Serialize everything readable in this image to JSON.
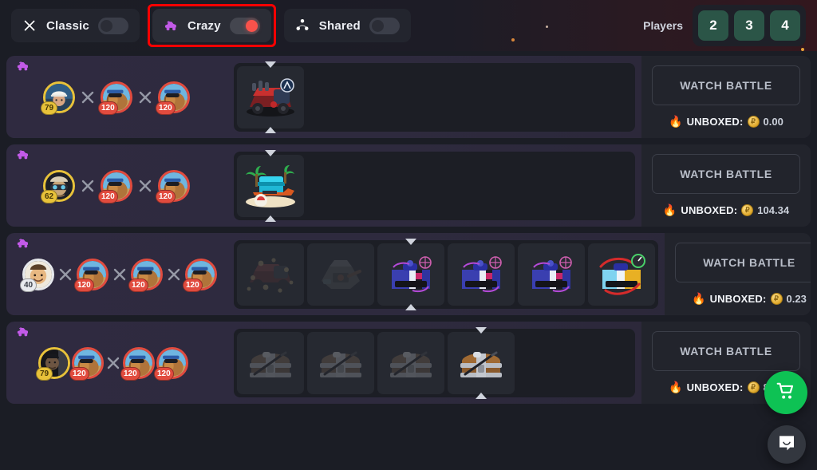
{
  "topbar": {
    "modes": [
      {
        "label": "Classic",
        "icon": "crossed-swords-icon",
        "toggle_on": false
      },
      {
        "label": "Crazy",
        "icon": "crazy-car-icon",
        "toggle_on": true,
        "highlighted": true
      },
      {
        "label": "Shared",
        "icon": "share-nodes-icon",
        "toggle_on": false
      }
    ],
    "players_label": "Players",
    "players_options": [
      "2",
      "3",
      "4"
    ],
    "accent_toggle_on": "#f9524b",
    "accent_players": "#2b5547",
    "highlight_color": "#ff0000"
  },
  "battles": [
    {
      "mode_icon": "crazy-car-icon",
      "layout": "ffa",
      "players": [
        {
          "level": "79",
          "ring": "gold",
          "avatar": "photo-hardhat-man"
        },
        {
          "level": "120",
          "ring": "red",
          "avatar": "photo-dog-sunglasses"
        },
        {
          "level": "120",
          "ring": "red",
          "avatar": "photo-dog-sunglasses"
        }
      ],
      "cases": [
        {
          "art": "war-truck-case",
          "dim": false,
          "marked": true
        }
      ],
      "watch_label": "WATCH BATTLE",
      "unboxed_label": "UNBOXED:",
      "unboxed_value": "0.00"
    },
    {
      "mode_icon": "crazy-car-icon",
      "layout": "ffa",
      "players": [
        {
          "level": "62",
          "ring": "gold",
          "avatar": "photo-goggles-man"
        },
        {
          "level": "120",
          "ring": "red",
          "avatar": "photo-dog-sunglasses"
        },
        {
          "level": "120",
          "ring": "red",
          "avatar": "photo-dog-sunglasses"
        }
      ],
      "cases": [
        {
          "art": "beach-case",
          "dim": false,
          "marked": true
        }
      ],
      "watch_label": "WATCH BATTLE",
      "unboxed_label": "UNBOXED:",
      "unboxed_value": "104.34"
    },
    {
      "mode_icon": "crazy-car-icon",
      "layout": "ffa4",
      "players": [
        {
          "level": "40",
          "ring": "silver",
          "avatar": "photo-smiling-man"
        },
        {
          "level": "120",
          "ring": "red",
          "avatar": "photo-dog-sunglasses"
        },
        {
          "level": "120",
          "ring": "red",
          "avatar": "photo-dog-sunglasses"
        },
        {
          "level": "120",
          "ring": "red",
          "avatar": "photo-dog-sunglasses"
        }
      ],
      "cases": [
        {
          "art": "red-truck-case",
          "dim": true,
          "marked": false
        },
        {
          "art": "grey-mech-case",
          "dim": true,
          "marked": false
        },
        {
          "art": "pink-blue-case",
          "dim": false,
          "marked": true
        },
        {
          "art": "pink-blue-case",
          "dim": false,
          "marked": false
        },
        {
          "art": "pink-blue-case",
          "dim": false,
          "marked": false
        },
        {
          "art": "gold-blue-case",
          "dim": false,
          "marked": false
        }
      ],
      "watch_label": "WATCH BATTLE",
      "unboxed_label": "UNBOXED:",
      "unboxed_value": "0.23"
    },
    {
      "mode_icon": "crazy-car-icon",
      "layout": "team",
      "players": [
        {
          "level": "79",
          "ring": "gold",
          "avatar": "photo-dark-man"
        },
        {
          "level": "120",
          "ring": "red",
          "avatar": "photo-dog-sunglasses"
        },
        {
          "level": "120",
          "ring": "red",
          "avatar": "photo-dog-sunglasses"
        },
        {
          "level": "120",
          "ring": "red",
          "avatar": "photo-dog-sunglasses"
        }
      ],
      "cases": [
        {
          "art": "wood-chest-case",
          "dim": true,
          "marked": false
        },
        {
          "art": "wood-chest-case",
          "dim": true,
          "marked": false
        },
        {
          "art": "wood-chest-case",
          "dim": true,
          "marked": false
        },
        {
          "art": "wood-chest-case",
          "dim": false,
          "marked": true
        }
      ],
      "watch_label": "WATCH BATTLE",
      "unboxed_label": "UNBOXED:",
      "unboxed_value": "8.68"
    }
  ],
  "floating": {
    "cart_icon": "shopping-cart-icon",
    "cart_color": "#0ec254",
    "chat_icon": "messenger-smile-icon"
  }
}
